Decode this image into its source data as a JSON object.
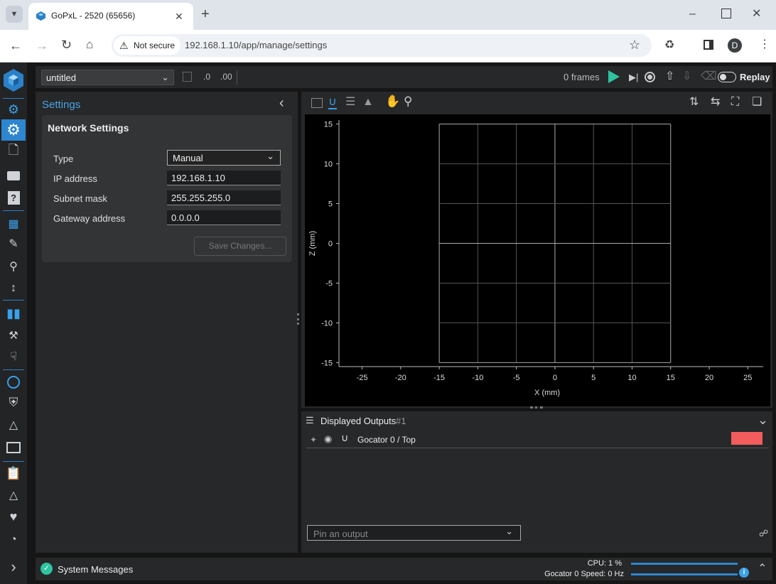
{
  "browser": {
    "tab_title": "GoPxL - 2520 (65656)",
    "security_label": "Not secure",
    "url": "192.168.1.10/app/manage/settings",
    "profile_initial": "D"
  },
  "toolbar": {
    "job_name": "untitled",
    "frames_label": "0 frames",
    "replay_label": "Replay"
  },
  "settings": {
    "header": "Settings",
    "card_title": "Network Settings",
    "fields": [
      {
        "label": "Type",
        "value": "Manual"
      },
      {
        "label": "IP address",
        "value": "192.168.1.10"
      },
      {
        "label": "Subnet mask",
        "value": "255.255.255.0"
      },
      {
        "label": "Gateway address",
        "value": "0.0.0.0"
      }
    ],
    "save_button": "Save Changes..."
  },
  "chart_data": {
    "type": "scatter",
    "xlabel": "X (mm)",
    "ylabel": "Z (mm)",
    "xlim": [
      -28,
      27
    ],
    "ylim": [
      -15.5,
      15.5
    ],
    "xticks": [
      -25,
      -20,
      -15,
      -10,
      -5,
      0,
      5,
      10,
      15,
      20,
      25
    ],
    "yticks": [
      15,
      10,
      5,
      0,
      -5,
      -10,
      -15
    ],
    "grid": true,
    "grid_box": {
      "x": [
        -15,
        15
      ],
      "y": [
        -15,
        15
      ]
    },
    "series": []
  },
  "outputs": {
    "title": "Displayed Outputs",
    "count": "#1",
    "items": [
      {
        "name": "Gocator 0 / Top",
        "color": "#f25c5c"
      }
    ],
    "pin_placeholder": "Pin an output"
  },
  "status": {
    "messages_label": "System Messages",
    "cpu_label": "CPU: 1 %",
    "speed_label": "Gocator 0 Speed: 0 Hz"
  },
  "colors": {
    "accent": "#3aa0e8",
    "play": "#2fc3a0"
  }
}
